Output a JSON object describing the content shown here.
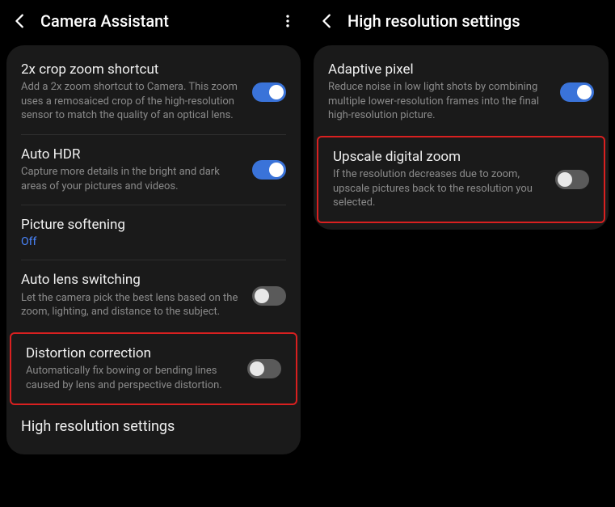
{
  "left": {
    "title": "Camera Assistant",
    "items": [
      {
        "title": "2x crop zoom shortcut",
        "desc": "Add a 2x zoom shortcut to Camera. This zoom uses a remosaiced crop of the high-resolution sensor to match the quality of an optical lens.",
        "toggle": "on"
      },
      {
        "title": "Auto HDR",
        "desc": "Capture more details in the bright and dark areas of your pictures and videos.",
        "toggle": "on"
      },
      {
        "title": "Picture softening",
        "status": "Off"
      },
      {
        "title": "Auto lens switching",
        "desc": "Let the camera pick the best lens based on the zoom, lighting, and distance to the subject.",
        "toggle": "off"
      },
      {
        "title": "Distortion correction",
        "desc": "Automatically fix bowing or bending lines caused by lens and perspective distortion.",
        "toggle": "off"
      },
      {
        "title": "High resolution settings"
      }
    ]
  },
  "right": {
    "title": "High resolution settings",
    "items": [
      {
        "title": "Adaptive pixel",
        "desc": "Reduce noise in low light shots by combining multiple lower-resolution frames into the final high-resolution picture.",
        "toggle": "on"
      },
      {
        "title": "Upscale digital zoom",
        "desc": "If the resolution decreases due to zoom, upscale pictures back to the resolution you selected.",
        "toggle": "off"
      }
    ]
  }
}
